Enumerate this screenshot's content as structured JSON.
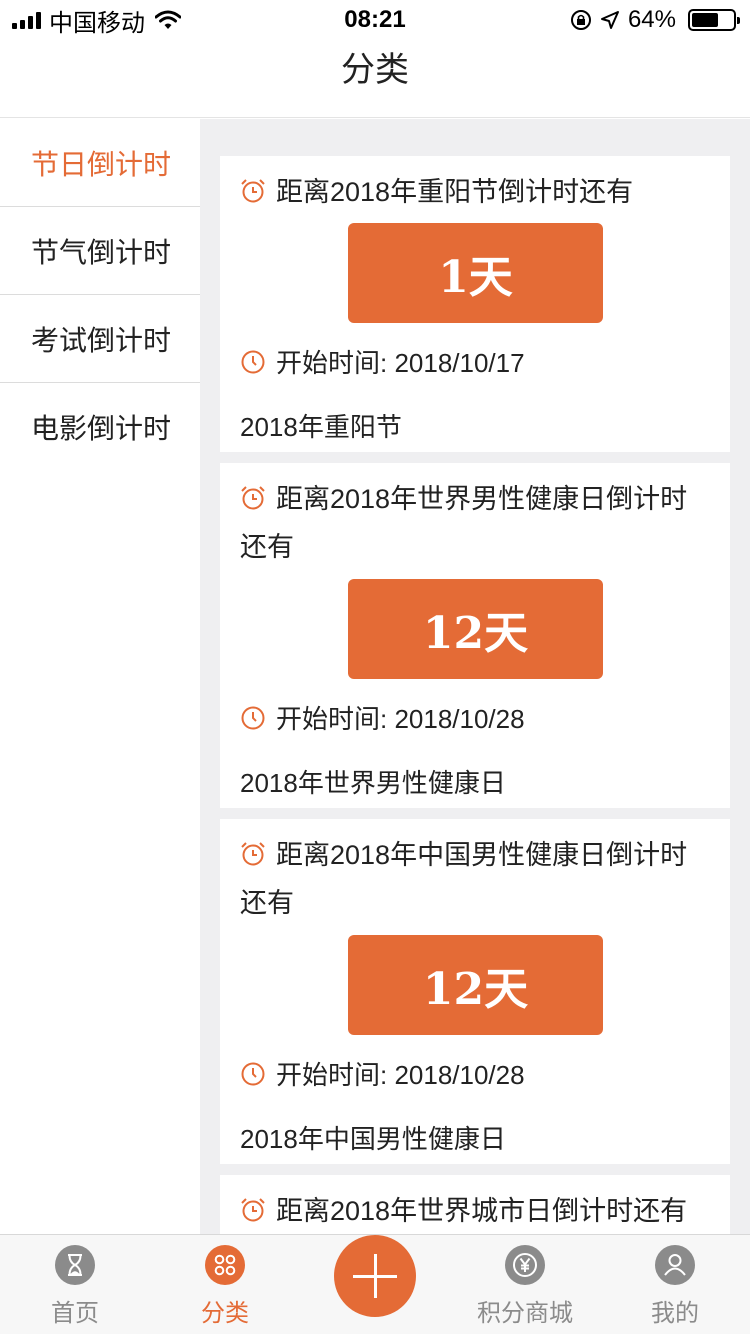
{
  "status_bar": {
    "carrier": "中国移动",
    "time": "08:21",
    "battery": "64%",
    "battery_level": 0.64
  },
  "nav": {
    "title": "分类"
  },
  "sidebar": {
    "items": [
      {
        "label": "节日倒计时",
        "active": true
      },
      {
        "label": "节气倒计时",
        "active": false
      },
      {
        "label": "考试倒计时",
        "active": false
      },
      {
        "label": "电影倒计时",
        "active": false
      }
    ]
  },
  "cards": [
    {
      "title": "距离2018年重阳节倒计时还有",
      "days": "1天",
      "start": "开始时间: 2018/10/17",
      "name": "2018年重阳节"
    },
    {
      "title": "距离2018年世界男性健康日倒计时还有",
      "days": "12天",
      "start": "开始时间: 2018/10/28",
      "name": "2018年世界男性健康日"
    },
    {
      "title": "距离2018年中国男性健康日倒计时还有",
      "days": "12天",
      "start": "开始时间: 2018/10/28",
      "name": "2018年中国男性健康日"
    },
    {
      "title": "距离2018年世界城市日倒计时还有"
    }
  ],
  "tabbar": {
    "home": "首页",
    "category": "分类",
    "points_mall": "积分商城",
    "mine": "我的",
    "icons": [
      "hourglass-icon",
      "grid-icon",
      "plus-icon",
      "yen-icon",
      "user-icon"
    ]
  },
  "colors": {
    "accent": "#e46b36",
    "background": "#efeff1",
    "inactive": "#8b8b8b"
  }
}
